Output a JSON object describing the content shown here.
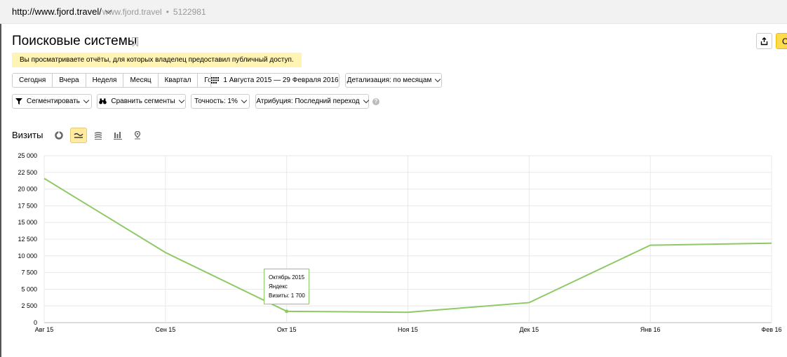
{
  "topbar": {
    "site_url": "http://www.fjord.travel/",
    "site_name": "www.fjord.travel",
    "counter_id": "5122981"
  },
  "header": {
    "title": "Поисковые системы",
    "yellow_button_label": "С"
  },
  "notice": "Вы просматриваете отчёты, для которых владелец предоставил публичный доступ.",
  "period": {
    "buttons": [
      "Сегодня",
      "Вчера",
      "Неделя",
      "Месяц",
      "Квартал",
      "Год"
    ],
    "date_range": "1 Августа 2015 — 29 Февраля 2016",
    "detail": "Детализация: по месяцам"
  },
  "filters": {
    "segment": "Сегментировать",
    "compare": "Сравнить сегменты",
    "accuracy": "Точность: 1%",
    "attribution": "Атрибуция: Последний переход",
    "help": "?"
  },
  "chart_section": {
    "label": "Визиты",
    "views": [
      "pie-chart-icon",
      "line-chart-icon",
      "area-chart-icon",
      "bar-chart-icon",
      "map-icon"
    ],
    "active_view": "line-chart-icon"
  },
  "tooltip": {
    "month": "Октябрь 2015",
    "source": "Яндекс",
    "metric": "Визиты: 1 700"
  },
  "chart_data": {
    "type": "line",
    "x": [
      "Авг 15",
      "Сен 15",
      "Окт 15",
      "Ноя 15",
      "Дек 15",
      "Янв 16",
      "Фев 16"
    ],
    "series": [
      {
        "name": "Яндекс",
        "values": [
          21600,
          10500,
          1700,
          1550,
          3000,
          11600,
          11900
        ],
        "color": "#8dca66"
      }
    ],
    "y_ticks": [
      "0",
      "2 500",
      "5 000",
      "7 500",
      "10 000",
      "12 500",
      "15 000",
      "17 500",
      "20 000",
      "22 500",
      "25 000"
    ],
    "ylim": [
      0,
      25000
    ],
    "grid": true,
    "highlighted_index": 2
  }
}
